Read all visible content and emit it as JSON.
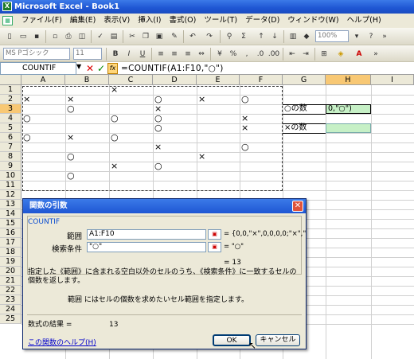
{
  "window": {
    "title": "Microsoft Excel - Book1"
  },
  "menu": [
    "ファイル(F)",
    "編集(E)",
    "表示(V)",
    "挿入(I)",
    "書式(O)",
    "ツール(T)",
    "データ(D)",
    "ウィンドウ(W)",
    "ヘルプ(H)"
  ],
  "toolbar": {
    "zoom": "100%",
    "font_name": "MS Pゴシック",
    "font_size": "11"
  },
  "formula_bar": {
    "name_box": "COUNTIF",
    "formula": "=COUNTIF(A1:F10,\"○\")"
  },
  "columns": [
    "A",
    "B",
    "C",
    "D",
    "E",
    "F",
    "G",
    "H",
    "I"
  ],
  "rows": [
    "1",
    "2",
    "3",
    "4",
    "5",
    "6",
    "7",
    "8",
    "9",
    "10",
    "11",
    "12",
    "13",
    "14",
    "15",
    "16",
    "17",
    "18",
    "19",
    "20",
    "21",
    "22",
    "23",
    "24",
    "25"
  ],
  "cells": {
    "C1": "×",
    "A2": "×",
    "B2": "×",
    "D2": "○",
    "E2": "×",
    "F2": "○",
    "B3": "○",
    "D3": "×",
    "A4": "○",
    "C4": "○",
    "D4": "○",
    "F4": "×",
    "D5": "○",
    "F5": "×",
    "A6": "○",
    "B6": "×",
    "C6": "○",
    "D7": "×",
    "F7": "○",
    "B8": "○",
    "E8": "×",
    "C9": "×",
    "D9": "○",
    "B10": "○",
    "G3": "○の数",
    "H3": "0,\"○\")",
    "G5": "×の数"
  },
  "dialog": {
    "title": "関数の引数",
    "function_name": "COUNTIF",
    "arg1_label": "範囲",
    "arg1_value": "A1:F10",
    "arg1_result": "= {0,0,\"×\",0,0,0,0;\"×\",\"",
    "arg2_label": "検索条件",
    "arg2_value": "\"○\"",
    "arg2_result": "= \"○\"",
    "eq_result": "= 13",
    "description": "指定した《範囲》に含まれる空白以外のセルのうち、《検索条件》に一致するセルの個数を返します。",
    "arg_help": "範囲  にはセルの個数を求めたいセル範囲を指定します。",
    "formula_result_label": "数式の結果 =",
    "formula_result_value": "13",
    "help_link": "この関数のヘルプ(H)",
    "ok": "OK",
    "cancel": "キャンセル"
  }
}
